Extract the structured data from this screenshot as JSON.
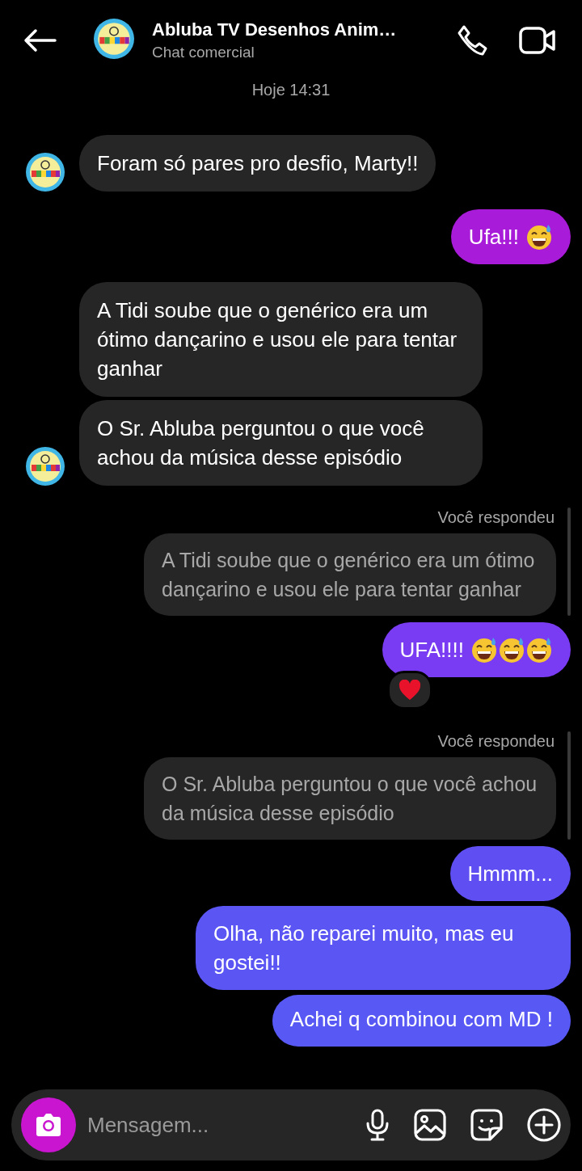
{
  "header": {
    "title": "Abluba TV Desenhos Anim…",
    "subtitle": "Chat comercial"
  },
  "messages": [
    {
      "kind": "timestamp",
      "text": "Hoje 14:31"
    },
    {
      "kind": "received",
      "text": "Foram só pares pro desfio, Marty!!",
      "avatar": true
    },
    {
      "kind": "sent",
      "text": "Ufa!!!",
      "color": "#a81bd8",
      "emojis": [
        {
          "kind": "grin-sweat"
        }
      ]
    },
    {
      "kind": "received",
      "text": "A Tidi soube que o genérico era um ótimo dançarino e usou ele para tentar ganhar",
      "avatar": false
    },
    {
      "kind": "received",
      "text": "O Sr. Abluba perguntou o que você achou da música desse episódio",
      "avatar": true
    },
    {
      "kind": "reply_label",
      "text": "Você respondeu"
    },
    {
      "kind": "quoted",
      "text": "A Tidi soube que o genérico era um ótimo dançarino e usou ele para tentar ganhar"
    },
    {
      "kind": "sent",
      "text": "UFA!!!!",
      "color": "#7a3cf2",
      "emojis": [
        {
          "kind": "grin-sweat"
        },
        {
          "kind": "grin-sweat"
        },
        {
          "kind": "grin-sweat"
        }
      ],
      "reaction": {
        "kind": "heart"
      }
    },
    {
      "kind": "reply_label",
      "text": "Você respondeu"
    },
    {
      "kind": "quoted",
      "text": "O Sr. Abluba perguntou o que você achou da música desse episódio"
    },
    {
      "kind": "sent",
      "text": "Hmmm...",
      "color": "#5f4ff2"
    },
    {
      "kind": "sent",
      "text": "Olha, não reparei muito, mas eu gostei!!",
      "color": "#5a55f3"
    },
    {
      "kind": "sent",
      "text": "Achei q combinou com MD !",
      "color": "#5858f4"
    }
  ],
  "composer": {
    "placeholder": "Mensagem..."
  }
}
